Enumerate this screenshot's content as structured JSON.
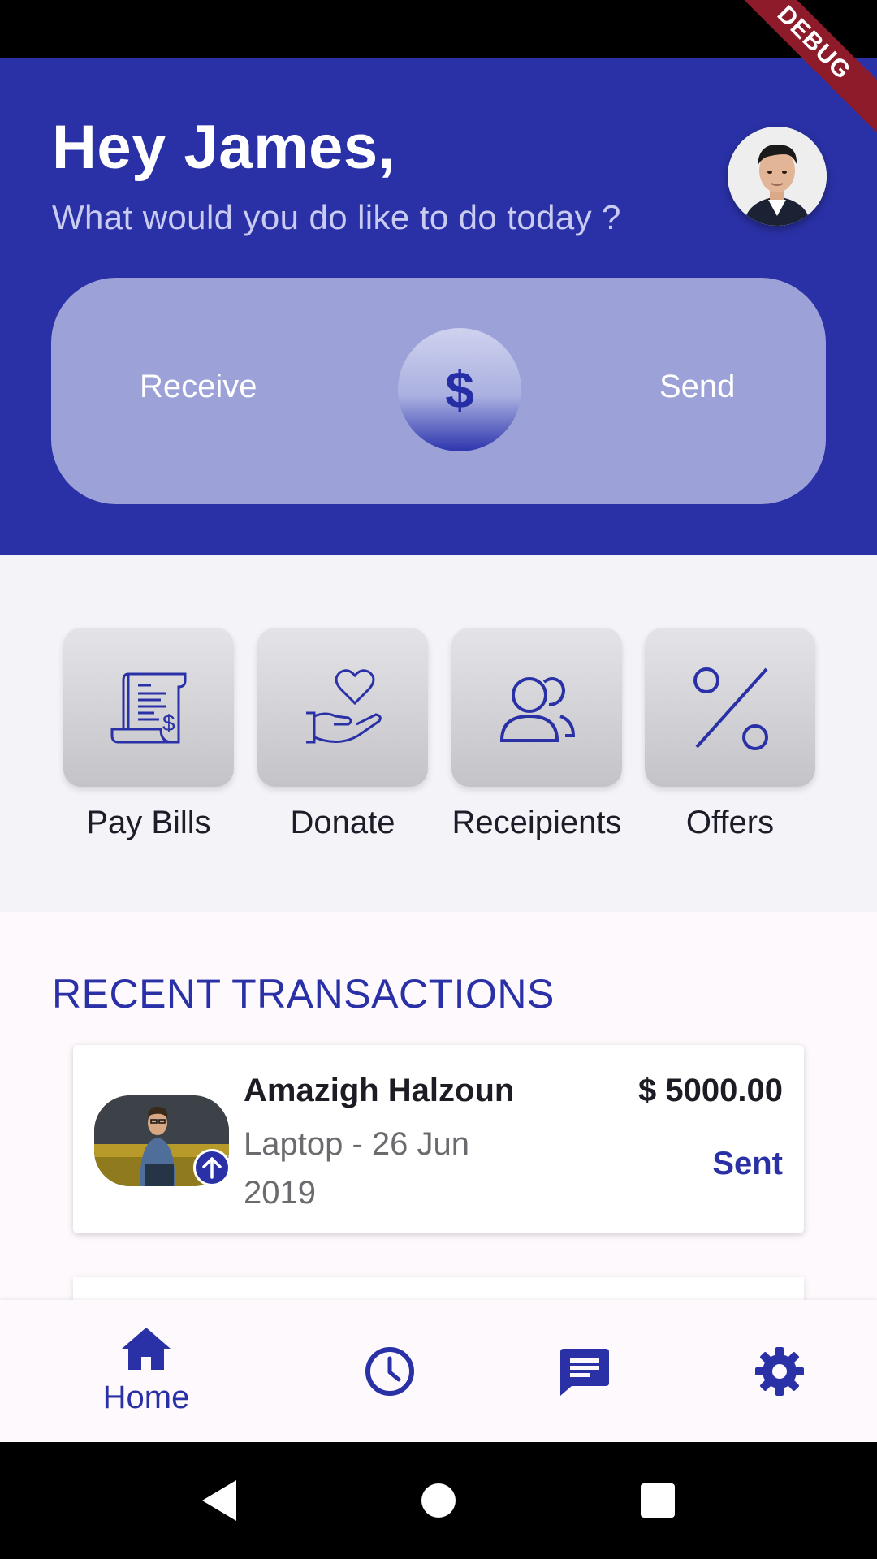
{
  "app": {
    "debug_banner": "DEBUG"
  },
  "header": {
    "greeting": "Hey James,",
    "subtitle": "What would you do like to do today ?",
    "avatar_icon": "user-avatar-photo"
  },
  "transfer": {
    "receive_label": "Receive",
    "send_label": "Send",
    "center_symbol": "$"
  },
  "quick_actions": [
    {
      "label": "Pay Bills",
      "icon": "receipt-dollar-icon"
    },
    {
      "label": "Donate",
      "icon": "heart-hand-icon"
    },
    {
      "label": "Receipients",
      "icon": "users-icon"
    },
    {
      "label": "Offers",
      "icon": "percent-icon"
    }
  ],
  "transactions": {
    "title": "RECENT TRANSACTIONS",
    "items": [
      {
        "name": "Amazigh Halzoun",
        "description": "Laptop - 26 Jun 2019",
        "amount": "$ 5000.00",
        "status": "Sent",
        "badge_icon": "arrow-up-icon"
      }
    ]
  },
  "bottom_nav": {
    "items": [
      {
        "label": "Home",
        "icon": "home-icon",
        "active": true
      },
      {
        "label": "",
        "icon": "history-clock-icon",
        "active": false
      },
      {
        "label": "",
        "icon": "message-icon",
        "active": false
      },
      {
        "label": "",
        "icon": "settings-gear-icon",
        "active": false
      }
    ]
  },
  "colors": {
    "primary": "#2a31a6",
    "panel": "#9ca2d8",
    "background": "#f3f3f8"
  }
}
